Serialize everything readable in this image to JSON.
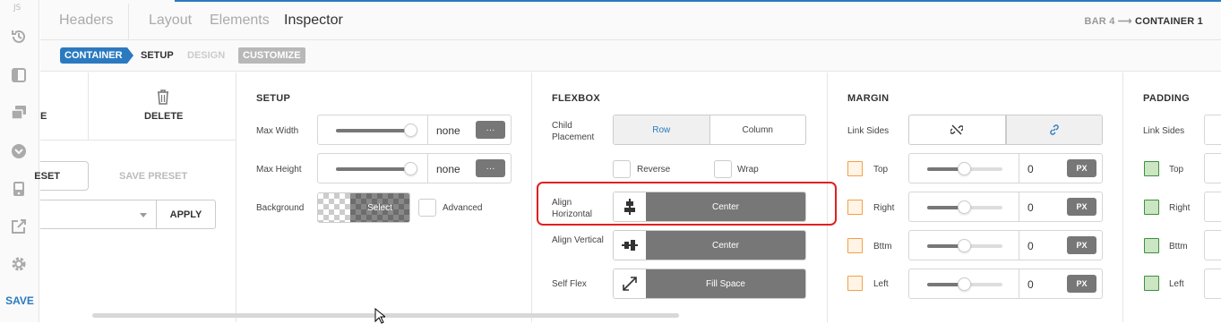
{
  "tabs": [
    "Headers",
    "Layout",
    "Elements",
    "Inspector"
  ],
  "breadcrumb": {
    "parent": "BAR 4",
    "arrow": "⟶",
    "current": "CONTAINER 1"
  },
  "subtabs": {
    "container": "CONTAINER",
    "setup": "SETUP",
    "design": "DESIGN",
    "customize": "CUSTOMIZE"
  },
  "rail": {
    "save": "SAVE",
    "icons": [
      "history-icon",
      "panel-icon",
      "copy-icon",
      "circle-arrow-icon",
      "device-icon",
      "external-link-icon",
      "gear-icon"
    ]
  },
  "presets": {
    "delete": "DELETE",
    "reset_partial": "ESET",
    "save_preset": "SAVE PRESET",
    "apply": "APPLY",
    "delete_partial_left": "E"
  },
  "setup": {
    "heading": "SETUP",
    "max_width": {
      "label": "Max Width",
      "value": "none",
      "btn": "···",
      "level": 0.93
    },
    "max_height": {
      "label": "Max Height",
      "value": "none",
      "btn": "···",
      "level": 0.93
    },
    "background": {
      "label": "Background",
      "select": "Select",
      "advanced": "Advanced"
    }
  },
  "flexbox": {
    "heading": "FLEXBOX",
    "child_placement": {
      "label": "Child Placement",
      "options": [
        "Row",
        "Column"
      ],
      "selected": "Row"
    },
    "reverse": "Reverse",
    "wrap": "Wrap",
    "align_horizontal": {
      "label": "Align Horizontal",
      "value": "Center"
    },
    "align_vertical": {
      "label": "Align Vertical",
      "value": "Center"
    },
    "self_flex": {
      "label": "Self Flex",
      "value": "Fill Space"
    }
  },
  "margin": {
    "heading": "MARGIN",
    "link_sides": "Link Sides",
    "sides": [
      {
        "label": "Top",
        "value": "0",
        "unit": "PX"
      },
      {
        "label": "Right",
        "value": "0",
        "unit": "PX"
      },
      {
        "label": "Bttm",
        "value": "0",
        "unit": "PX"
      },
      {
        "label": "Left",
        "value": "0",
        "unit": "PX"
      }
    ]
  },
  "padding": {
    "heading": "PADDING",
    "link_sides": "Link Sides",
    "sides": [
      {
        "label": "Top"
      },
      {
        "label": "Right"
      },
      {
        "label": "Bttm"
      },
      {
        "label": "Left"
      }
    ]
  },
  "colors": {
    "accent": "#2b7ac0",
    "highlight": "#e02020",
    "margin_icon": "#f0a04b",
    "padding_icon": "#3e8e41"
  }
}
